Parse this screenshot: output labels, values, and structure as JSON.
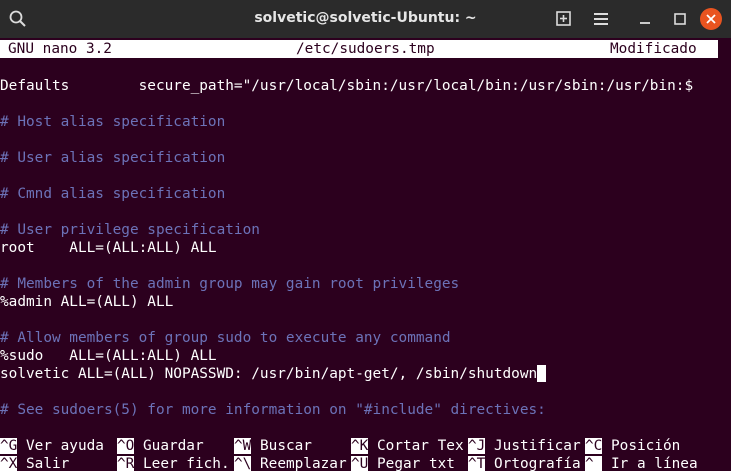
{
  "window": {
    "title": "solvetic@solvetic-Ubuntu: ~",
    "icons": [
      "search-icon",
      "new-tab-icon",
      "hamburger-menu-icon",
      "minimize-icon",
      "maximize-icon",
      "close-icon"
    ]
  },
  "nano_header": {
    "version": "GNU nano 3.2",
    "filename": "/etc/sudoers.tmp",
    "status": "Modificado"
  },
  "lines": {
    "l1": "Defaults        secure_path=\"/usr/local/sbin:/usr/local/bin:/usr/sbin:/usr/bin:$",
    "l2": "# Host alias specification",
    "l3": "# User alias specification",
    "l4": "# Cmnd alias specification",
    "l5": "# User privilege specification",
    "l6": "root    ALL=(ALL:ALL) ALL",
    "l7": "# Members of the admin group may gain root privileges",
    "l8": "%admin ALL=(ALL) ALL",
    "l9": "# Allow members of group sudo to execute any command",
    "l10": "%sudo   ALL=(ALL:ALL) ALL",
    "l11": "solvetic ALL=(ALL) NOPASSWD: /usr/bin/apt-get/, /sbin/shutdown",
    "l12": "# See sudoers(5) for more information on \"#include\" directives:"
  },
  "shortcuts_row1": [
    {
      "key": "^G",
      "label": " Ver ayuda"
    },
    {
      "key": "^O",
      "label": " Guardar"
    },
    {
      "key": "^W",
      "label": " Buscar"
    },
    {
      "key": "^K",
      "label": " Cortar Tex"
    },
    {
      "key": "^J",
      "label": " Justificar"
    },
    {
      "key": "^C",
      "label": " Posición"
    }
  ],
  "shortcuts_row2": [
    {
      "key": "^X",
      "label": " Salir"
    },
    {
      "key": "^R",
      "label": " Leer fich."
    },
    {
      "key": "^\\",
      "label": " Reemplazar"
    },
    {
      "key": "^U",
      "label": " Pegar txt"
    },
    {
      "key": "^T",
      "label": " Ortografía"
    },
    {
      "key": "^_",
      "label": " Ir a línea"
    }
  ],
  "colors": {
    "terminal_bg": "#2c001e",
    "comment": "#6c72b8",
    "close_button": "#e95420"
  }
}
